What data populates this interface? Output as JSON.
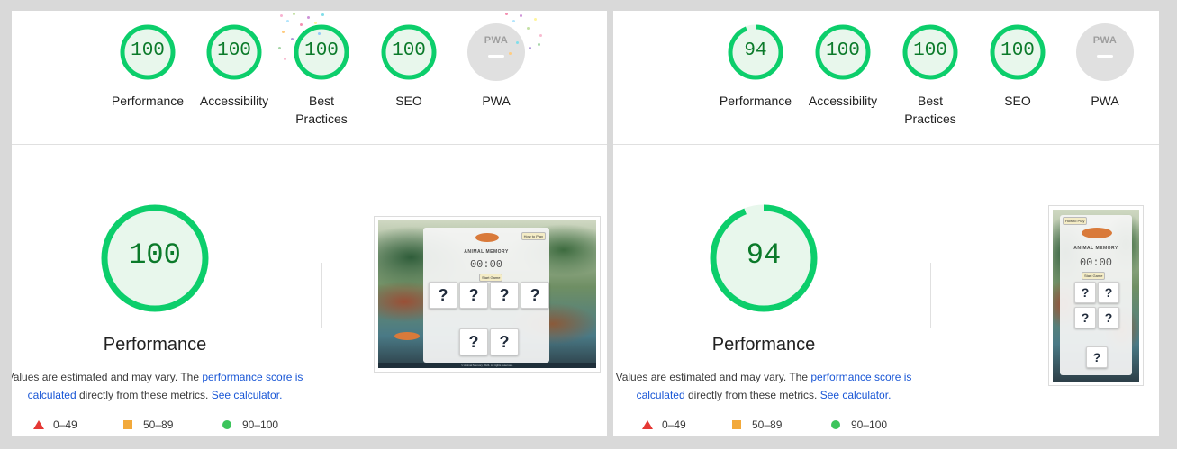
{
  "colors": {
    "pass_green": "#0cce6b",
    "pass_text": "#0b7a2a",
    "pass_fill": "#e8f7ec",
    "neutral_gray": "#e0e0e0",
    "fail_red": "#e53935",
    "average_orange": "#f2a93b",
    "link_blue": "#1a57d6"
  },
  "reports": [
    {
      "categories": [
        {
          "label": "Performance",
          "score": "100",
          "fraction": 1.0
        },
        {
          "label": "Accessibility",
          "score": "100",
          "fraction": 1.0
        },
        {
          "label": "Best Practices",
          "score": "100",
          "fraction": 1.0
        },
        {
          "label": "SEO",
          "score": "100",
          "fraction": 1.0
        },
        {
          "label": "PWA",
          "badge": "PWA",
          "score": ""
        }
      ],
      "main": {
        "score": "100",
        "fraction": 1.0,
        "title": "Performance",
        "desc_prefix": "Values are estimated and may vary. The ",
        "desc_link1": "performance score is calculated",
        "desc_middle": " directly from these metrics. ",
        "desc_link2": "See calculator."
      },
      "legend": [
        {
          "icon": "triangle-red",
          "range": "0–49"
        },
        {
          "icon": "square-orange",
          "range": "50–89"
        },
        {
          "icon": "circle-green",
          "range": "90–100"
        }
      ],
      "screenshot": {
        "title": "ANIMAL MEMORY",
        "timer": "00:00",
        "start_label": "Start Game",
        "howto_label": "How to Play",
        "card_mark": "?",
        "card_count": 6,
        "footer": "© Animal Memory 2024. All rights reserved."
      }
    },
    {
      "categories": [
        {
          "label": "Performance",
          "score": "94",
          "fraction": 0.94
        },
        {
          "label": "Accessibility",
          "score": "100",
          "fraction": 1.0
        },
        {
          "label": "Best Practices",
          "score": "100",
          "fraction": 1.0
        },
        {
          "label": "SEO",
          "score": "100",
          "fraction": 1.0
        },
        {
          "label": "PWA",
          "badge": "PWA",
          "score": ""
        }
      ],
      "main": {
        "score": "94",
        "fraction": 0.94,
        "title": "Performance",
        "desc_prefix": "Values are estimated and may vary. The ",
        "desc_link1": "performance score is calculated",
        "desc_middle": " directly from these metrics. ",
        "desc_link2": "See calculator."
      },
      "legend": [
        {
          "icon": "triangle-red",
          "range": "0–49"
        },
        {
          "icon": "square-orange",
          "range": "50–89"
        },
        {
          "icon": "circle-green",
          "range": "90–100"
        }
      ],
      "screenshot": {
        "title": "ANIMAL MEMORY",
        "timer": "00:00",
        "start_label": "Start Game",
        "howto_label": "How to Play",
        "card_mark": "?",
        "card_count": 5
      }
    }
  ]
}
